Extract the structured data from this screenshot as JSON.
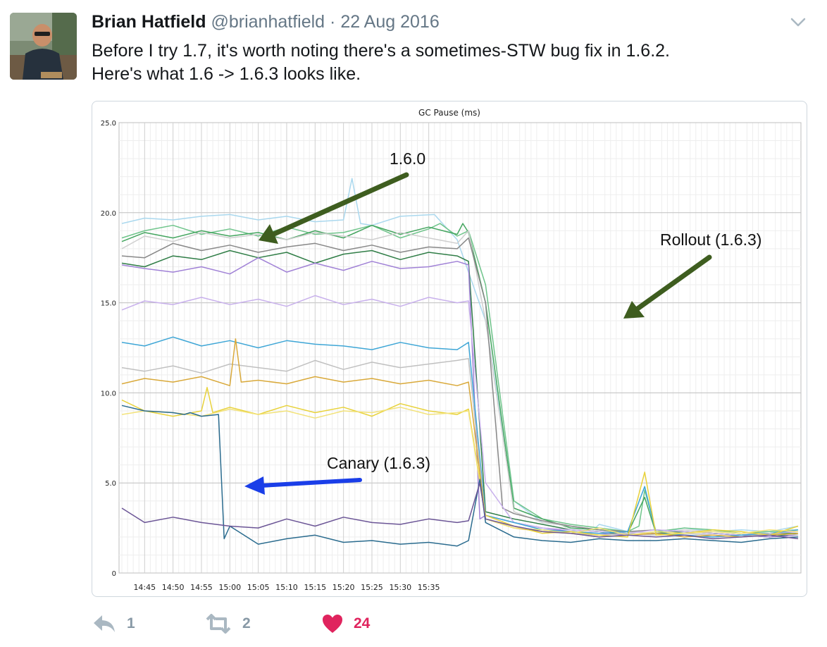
{
  "tweet": {
    "author_name": "Brian Hatfield",
    "handle": "@brianhatfield",
    "separator": "·",
    "date": "22 Aug 2016",
    "text_line1": "Before I try 1.7, it's worth noting there's a sometimes-STW bug fix in 1.6.2.",
    "text_line2": "Here's what 1.6 -> 1.6.3 looks like."
  },
  "actions": {
    "reply_count": "1",
    "retweet_count": "2",
    "like_count": "24",
    "like_color": "#e0245e",
    "reply_icon": "reply-icon",
    "retweet_icon": "retweet-icon",
    "like_icon": "heart-icon"
  },
  "chart_data": {
    "type": "line",
    "title": "GC Pause (ms)",
    "xlabel": "",
    "ylabel": "",
    "x_ticks": [
      "14:45",
      "14:50",
      "14:55",
      "15:00",
      "15:05",
      "15:10",
      "15:15",
      "15:20",
      "15:25",
      "15:30",
      "15:35"
    ],
    "y_ticks": [
      "25.0",
      "20.0",
      "15.0",
      "10.0",
      "5.0",
      "0"
    ],
    "ylim": [
      0,
      25
    ],
    "grid": true,
    "x_range_minutes": [
      41.0,
      160.0
    ],
    "series": [
      {
        "color": "#aad8ee",
        "x": [
          41,
          45,
          50,
          55,
          60,
          65,
          70,
          75,
          80,
          81.5,
          83,
          85,
          90,
          96,
          100,
          105,
          110,
          115,
          120,
          124,
          125,
          130,
          135,
          140,
          145,
          150,
          155,
          160
        ],
        "y": [
          19.4,
          19.7,
          19.6,
          19.8,
          19.9,
          19.6,
          19.8,
          19.5,
          19.6,
          21.9,
          19.4,
          19.3,
          19.8,
          19.9,
          18.5,
          14.0,
          4.0,
          2.8,
          2.6,
          2.4,
          2.7,
          2.3,
          2.2,
          2.5,
          2.3,
          2.4,
          2.3,
          2.6
        ]
      },
      {
        "color": "#6ec48a",
        "x": [
          41,
          45,
          50,
          55,
          60,
          65,
          70,
          75,
          80,
          85,
          90,
          95,
          97,
          100,
          102,
          105,
          110,
          115,
          120,
          125,
          130,
          132,
          133,
          135,
          140,
          145,
          150,
          155,
          160
        ],
        "y": [
          18.6,
          19.0,
          19.3,
          18.8,
          19.1,
          18.7,
          19.2,
          18.8,
          18.9,
          19.3,
          18.6,
          19.1,
          19.4,
          18.7,
          19.0,
          16.0,
          4.0,
          3.0,
          2.7,
          2.5,
          2.3,
          2.6,
          4.6,
          2.3,
          2.5,
          2.4,
          2.2,
          2.3,
          2.4
        ]
      },
      {
        "color": "#44a55f",
        "x": [
          41,
          45,
          50,
          55,
          60,
          65,
          70,
          75,
          80,
          85,
          90,
          95,
          100,
          101,
          102,
          105,
          110,
          115,
          120,
          125,
          130,
          133,
          135,
          140,
          145,
          150,
          155,
          160
        ],
        "y": [
          18.4,
          18.9,
          18.6,
          19.0,
          18.7,
          18.9,
          18.5,
          19.0,
          18.6,
          19.3,
          18.8,
          19.2,
          18.8,
          19.4,
          18.9,
          15.0,
          3.6,
          3.0,
          2.5,
          2.4,
          2.2,
          4.2,
          2.2,
          2.3,
          2.2,
          2.1,
          2.2,
          2.2
        ]
      },
      {
        "color": "#cfcfcf",
        "x": [
          41,
          45,
          50,
          55,
          60,
          65,
          70,
          75,
          80,
          85,
          90,
          95,
          100,
          102,
          105,
          110,
          115,
          120,
          125,
          130,
          135,
          140,
          145,
          150,
          155,
          160
        ],
        "y": [
          18.0,
          18.7,
          18.4,
          18.9,
          18.6,
          18.8,
          18.5,
          18.9,
          18.7,
          18.5,
          18.9,
          18.6,
          18.3,
          19.0,
          14.0,
          3.4,
          2.8,
          2.6,
          2.4,
          2.3,
          2.2,
          2.4,
          2.3,
          2.2,
          2.2,
          2.4
        ]
      },
      {
        "color": "#888888",
        "x": [
          41,
          45,
          50,
          55,
          60,
          65,
          70,
          75,
          80,
          85,
          90,
          95,
          100,
          102,
          105,
          108,
          110,
          115,
          120,
          125,
          130,
          135,
          140,
          145,
          150,
          155,
          160
        ],
        "y": [
          17.6,
          17.5,
          18.3,
          17.9,
          18.2,
          17.8,
          18.1,
          18.3,
          17.9,
          18.2,
          17.8,
          18.1,
          18.0,
          18.6,
          15.0,
          3.6,
          3.3,
          2.9,
          2.6,
          2.4,
          2.3,
          2.4,
          2.3,
          2.2,
          2.1,
          2.2,
          2.3
        ]
      },
      {
        "color": "#2f7d46",
        "x": [
          41,
          45,
          50,
          55,
          60,
          65,
          70,
          75,
          80,
          85,
          90,
          95,
          100,
          102,
          105,
          110,
          115,
          120,
          125,
          130,
          135,
          140,
          145,
          150,
          155,
          160
        ],
        "y": [
          17.2,
          17.0,
          17.6,
          17.4,
          17.9,
          17.5,
          17.8,
          17.2,
          17.7,
          17.9,
          17.4,
          17.8,
          17.6,
          17.3,
          3.4,
          3.0,
          2.7,
          2.4,
          2.3,
          2.1,
          2.2,
          2.3,
          2.2,
          2.1,
          2.0,
          2.2
        ]
      },
      {
        "color": "#a081d6",
        "x": [
          41,
          45,
          50,
          55,
          60,
          65,
          70,
          75,
          80,
          85,
          90,
          95,
          100,
          102,
          104,
          105,
          110,
          115,
          120,
          125,
          130,
          135,
          140,
          145,
          150,
          155,
          160
        ],
        "y": [
          17.1,
          16.9,
          16.7,
          17.0,
          16.6,
          17.5,
          16.7,
          17.2,
          16.8,
          17.3,
          16.9,
          17.0,
          17.3,
          17.1,
          3.0,
          3.2,
          2.8,
          2.5,
          2.3,
          2.2,
          2.1,
          2.2,
          2.1,
          2.0,
          2.1,
          2.0,
          2.1
        ]
      },
      {
        "color": "#c8b0ec",
        "x": [
          41,
          45,
          50,
          55,
          60,
          65,
          70,
          75,
          80,
          85,
          90,
          95,
          100,
          102,
          105,
          110,
          115,
          120,
          125,
          130,
          135,
          140,
          145,
          150,
          155,
          160
        ],
        "y": [
          14.6,
          15.1,
          14.9,
          15.3,
          14.9,
          15.2,
          14.8,
          15.4,
          14.9,
          15.2,
          14.8,
          15.3,
          15.0,
          15.1,
          5.0,
          2.8,
          2.5,
          2.4,
          2.3,
          2.2,
          2.4,
          2.3,
          2.2,
          2.1,
          2.2,
          2.3
        ]
      },
      {
        "color": "#3ea6d6",
        "x": [
          41,
          45,
          50,
          55,
          60,
          65,
          70,
          75,
          80,
          85,
          90,
          95,
          100,
          102,
          105,
          110,
          115,
          120,
          125,
          130,
          133,
          135,
          140,
          145,
          150,
          155,
          160
        ],
        "y": [
          12.8,
          12.6,
          13.1,
          12.6,
          12.9,
          12.5,
          12.9,
          12.7,
          12.6,
          12.4,
          12.8,
          12.5,
          12.4,
          12.8,
          3.2,
          2.8,
          2.4,
          2.3,
          2.2,
          2.3,
          4.8,
          2.2,
          2.1,
          2.0,
          2.1,
          2.2,
          2.4
        ]
      },
      {
        "color": "#c0c0c0",
        "x": [
          41,
          45,
          50,
          55,
          60,
          65,
          70,
          75,
          80,
          85,
          90,
          95,
          100,
          102,
          105,
          110,
          115,
          120,
          125,
          130,
          135,
          140,
          145,
          150,
          155,
          160
        ],
        "y": [
          11.4,
          11.2,
          11.5,
          11.1,
          11.6,
          11.4,
          11.2,
          11.8,
          11.3,
          11.7,
          11.4,
          11.6,
          11.8,
          11.9,
          3.0,
          2.6,
          2.3,
          2.2,
          2.1,
          2.2,
          2.1,
          2.2,
          2.1,
          2.0,
          2.2,
          2.1
        ]
      },
      {
        "color": "#d9a93a",
        "x": [
          41,
          45,
          50,
          55,
          60,
          61,
          62,
          65,
          70,
          75,
          80,
          85,
          90,
          95,
          100,
          102,
          105,
          110,
          115,
          120,
          125,
          130,
          135,
          140,
          145,
          150,
          155,
          160
        ],
        "y": [
          10.5,
          10.8,
          10.6,
          10.9,
          10.4,
          13.0,
          10.6,
          10.7,
          10.5,
          10.9,
          10.6,
          10.8,
          10.5,
          10.7,
          10.4,
          10.6,
          3.0,
          2.5,
          2.3,
          2.2,
          2.0,
          2.1,
          2.2,
          2.0,
          2.1,
          2.0,
          2.1,
          2.2
        ]
      },
      {
        "color": "#e8d23a",
        "x": [
          41,
          45,
          50,
          55,
          56,
          57,
          60,
          65,
          70,
          75,
          80,
          85,
          90,
          95,
          100,
          102,
          105,
          110,
          115,
          120,
          125,
          130,
          133,
          135,
          140,
          145,
          150,
          155,
          160
        ],
        "y": [
          9.6,
          9.0,
          8.7,
          9.0,
          10.3,
          8.9,
          9.2,
          8.8,
          9.3,
          8.9,
          9.2,
          8.7,
          9.4,
          9.0,
          8.8,
          9.1,
          3.2,
          2.6,
          2.2,
          2.3,
          2.1,
          2.0,
          5.6,
          2.1,
          2.2,
          2.4,
          2.3,
          2.1,
          2.6
        ]
      },
      {
        "color": "#f2e27a",
        "x": [
          41,
          45,
          50,
          55,
          60,
          65,
          70,
          75,
          80,
          85,
          90,
          95,
          100,
          102,
          105,
          110,
          115,
          120,
          125,
          130,
          135,
          140,
          145,
          150,
          155,
          160
        ],
        "y": [
          8.8,
          9.0,
          8.9,
          8.7,
          9.1,
          8.8,
          9.0,
          8.6,
          9.0,
          8.9,
          9.2,
          8.8,
          8.9,
          9.0,
          3.0,
          2.5,
          2.4,
          2.2,
          2.5,
          2.1,
          2.3,
          2.2,
          2.3,
          2.2,
          2.4,
          2.3
        ]
      },
      {
        "color": "#2a6b8e",
        "x": [
          41,
          45,
          50,
          52,
          53,
          55,
          58,
          59,
          60,
          65,
          70,
          75,
          80,
          85,
          90,
          95,
          100,
          102,
          104,
          105,
          110,
          115,
          120,
          125,
          130,
          135,
          140,
          145,
          150,
          155,
          160
        ],
        "y": [
          9.3,
          9.0,
          8.9,
          8.8,
          8.9,
          8.7,
          8.8,
          1.9,
          2.6,
          1.6,
          1.9,
          2.1,
          1.7,
          1.8,
          1.6,
          1.7,
          1.5,
          1.8,
          5.2,
          2.8,
          2.0,
          1.8,
          1.7,
          1.9,
          1.8,
          1.8,
          1.9,
          1.8,
          1.7,
          1.9,
          2.0
        ]
      },
      {
        "color": "#6b5596",
        "x": [
          41,
          45,
          50,
          55,
          60,
          65,
          70,
          75,
          80,
          85,
          90,
          95,
          100,
          102,
          104,
          105,
          110,
          115,
          120,
          125,
          130,
          135,
          140,
          145,
          150,
          155,
          160
        ],
        "y": [
          3.6,
          2.8,
          3.1,
          2.8,
          2.6,
          2.5,
          3.0,
          2.6,
          3.1,
          2.8,
          2.7,
          3.0,
          2.8,
          2.9,
          5.0,
          3.0,
          2.6,
          2.3,
          2.2,
          2.0,
          2.1,
          2.0,
          2.1,
          1.9,
          2.0,
          2.1,
          1.9
        ]
      }
    ],
    "annotations": [
      {
        "text": "1.6.0",
        "arrow_color": "#3e5d1f"
      },
      {
        "text": "Rollout (1.6.3)",
        "arrow_color": "#3e5d1f"
      },
      {
        "text": "Canary (1.6.3)",
        "arrow_color": "#1a3ee8"
      }
    ]
  }
}
